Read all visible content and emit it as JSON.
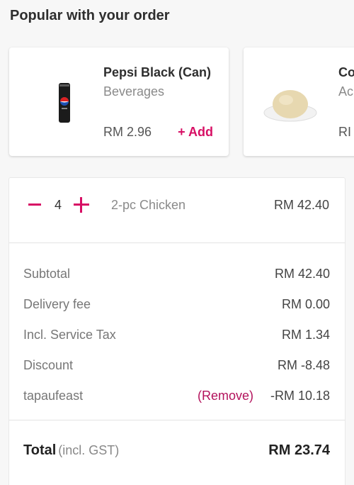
{
  "popular": {
    "title": "Popular with your order",
    "items": [
      {
        "name": "Pepsi Black (Can)",
        "category": "Beverages",
        "price": "RM 2.96",
        "add_label": "+ Add",
        "image_icon": "pepsi-can-image"
      },
      {
        "name": "Co",
        "category": "Ac",
        "price": "RI",
        "image_icon": "rice-dish-image"
      }
    ]
  },
  "cart": {
    "item": {
      "quantity": "4",
      "name": "2-pc Chicken",
      "price": "RM 42.40"
    },
    "lines": [
      {
        "label": "Subtotal",
        "value": "RM 42.40"
      },
      {
        "label": "Delivery fee",
        "value": "RM 0.00"
      },
      {
        "label": "Incl. Service Tax",
        "value": "RM 1.34"
      },
      {
        "label": "Discount",
        "value": "RM -8.48"
      },
      {
        "label": "tapaufeast",
        "value": "-RM 10.18",
        "action": "(Remove)"
      }
    ],
    "total": {
      "label": "Total",
      "sublabel": "(incl. GST)",
      "value": "RM 23.74"
    }
  },
  "colors": {
    "accent": "#d70f64",
    "remove": "#b3125c"
  }
}
